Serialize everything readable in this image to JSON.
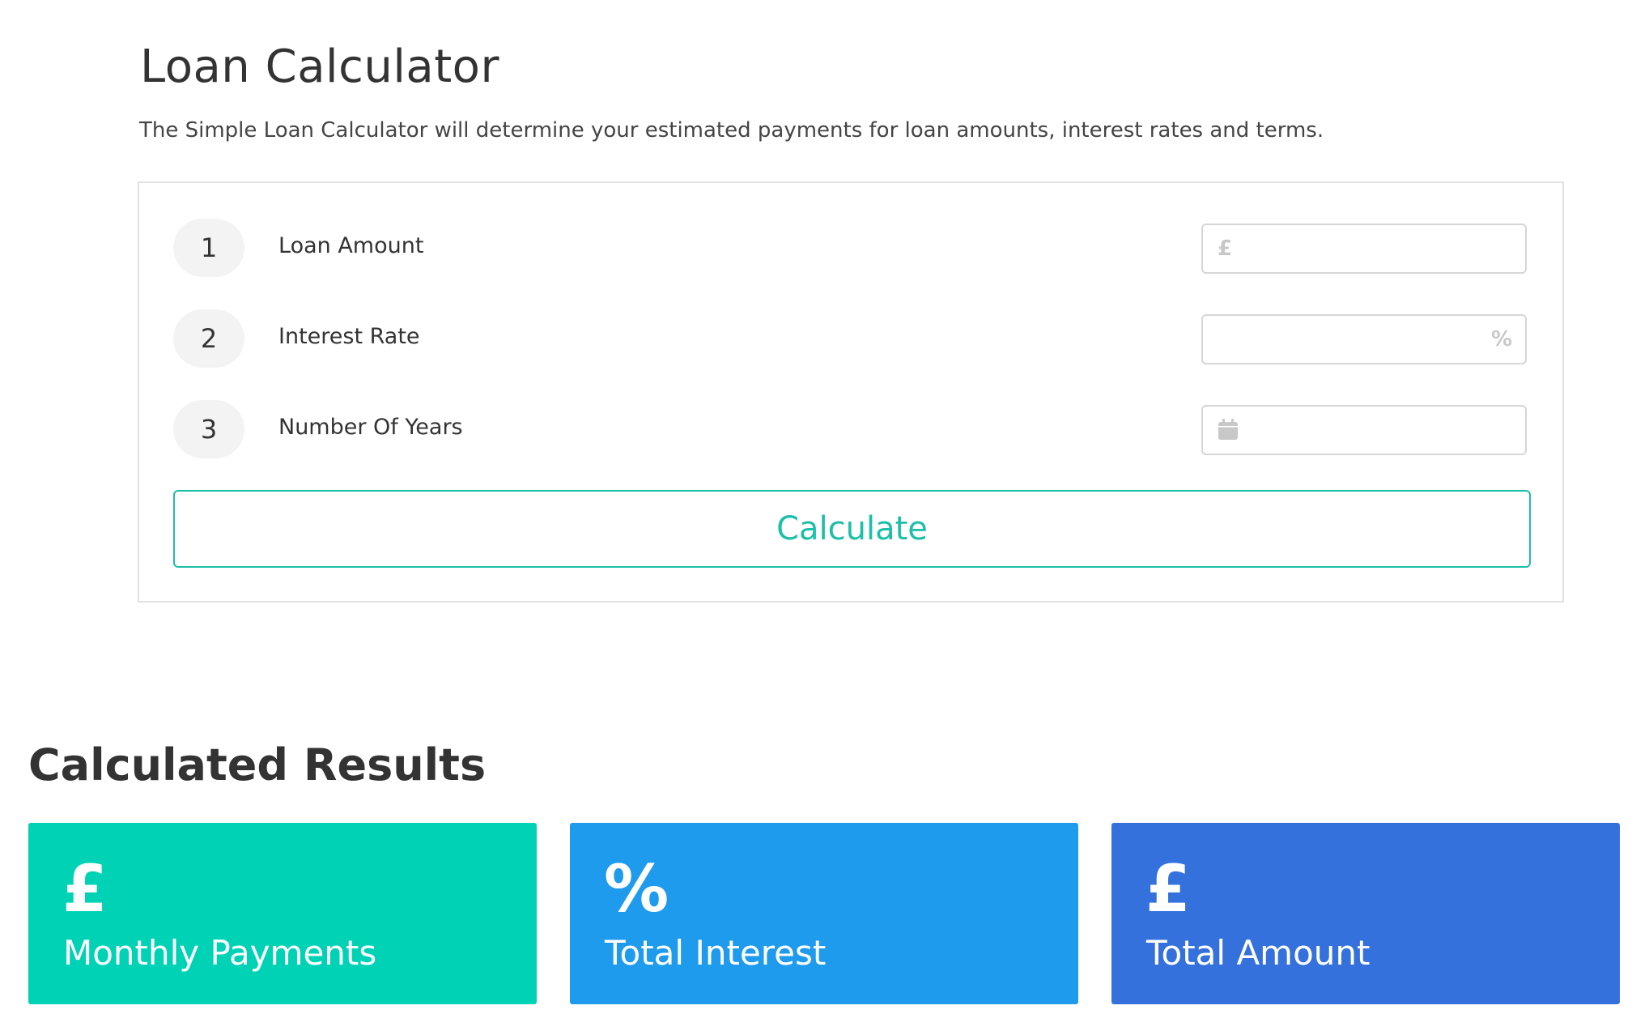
{
  "header": {
    "title": "Loan Calculator",
    "description": "The Simple Loan Calculator will determine your estimated payments for loan amounts, interest rates and terms."
  },
  "form": {
    "rows": [
      {
        "step": "1",
        "label": "Loan Amount",
        "icon": "pound-icon",
        "icon_glyph": "£",
        "value": "",
        "placeholder": ""
      },
      {
        "step": "2",
        "label": "Interest Rate",
        "icon": "percent-icon",
        "icon_glyph": "%",
        "value": "",
        "placeholder": ""
      },
      {
        "step": "3",
        "label": "Number Of Years",
        "icon": "calendar-icon",
        "value": "",
        "placeholder": ""
      }
    ],
    "calculate_label": "Calculate"
  },
  "results": {
    "heading": "Calculated Results",
    "cards": [
      {
        "symbol": "£",
        "label": "Monthly Payments",
        "color": "#00d2b5"
      },
      {
        "symbol": "%",
        "label": "Total Interest",
        "color": "#1f9bed"
      },
      {
        "symbol": "£",
        "label": "Total Amount",
        "color": "#3471dc"
      }
    ]
  },
  "colors": {
    "accent": "#1cbfa8",
    "badge_bg": "#f3f3f3",
    "card_border": "#e2e2e2"
  }
}
